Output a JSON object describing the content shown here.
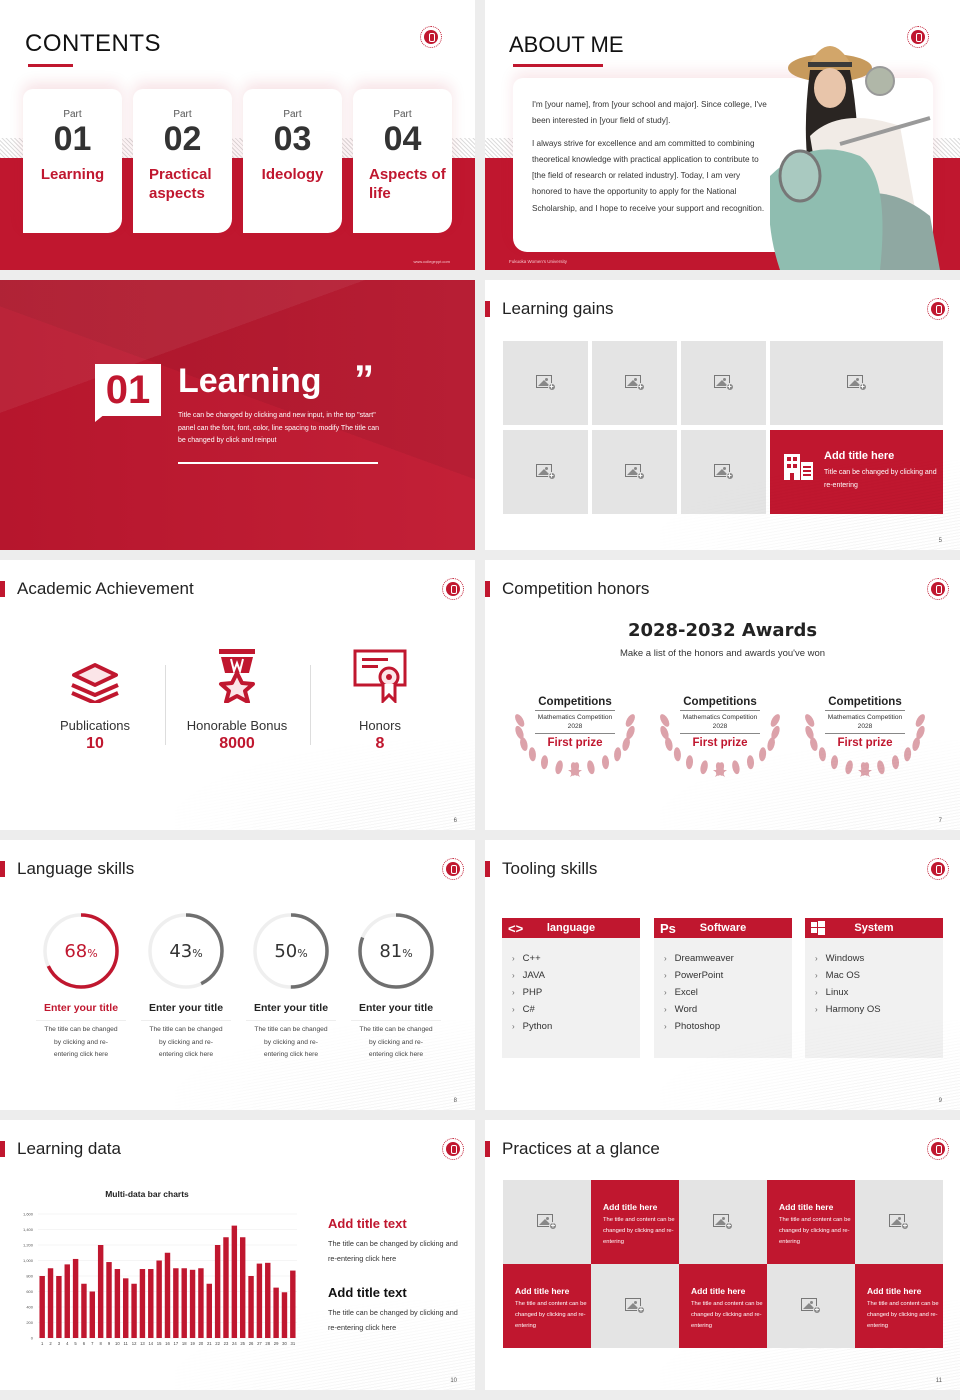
{
  "colors": {
    "accent": "#c0172f",
    "placeholder_gray": "#e4e4e4",
    "ring_gray": "#6f6f6f",
    "ring_track": "#efefef"
  },
  "slide1": {
    "title": "CONTENTS",
    "parts": [
      {
        "label": "Part",
        "number": "01",
        "name": "Learning"
      },
      {
        "label": "Part",
        "number": "02",
        "name": "Practical aspects"
      },
      {
        "label": "Part",
        "number": "03",
        "name": "Ideology"
      },
      {
        "label": "Part",
        "number": "04",
        "name": "Aspects of life"
      }
    ],
    "website": "www.collegeppt.com",
    "logo_icon": "university-seal-icon"
  },
  "slide2": {
    "title": "ABOUT ME",
    "bio_p1": "I'm [your name], from [your school and major]. Since college, I've been interested in [your field of study].",
    "bio_p2": "I always strive for excellence and am committed to combining theoretical knowledge with practical application to contribute to [the field of research or related industry]. Today, I am very honored to have the opportunity to apply for the National Scholarship, and I hope to receive your support and recognition.",
    "university": "Fukuoka Women's University",
    "photo": "student-on-scooter-photo"
  },
  "slide3": {
    "number": "01",
    "title": "Learning",
    "quote_mark": "”",
    "description": "Title can be changed by clicking and new input, in the top \"start\" panel can the font, font, color, line spacing to modify The title can be changed by click and reinput"
  },
  "slide4": {
    "title": "Learning gains",
    "placeholder_icon": "image-add-icon",
    "feature": {
      "icon": "building-icon",
      "title": "Add title here",
      "text": "Title can be changed by clicking and re-entering"
    },
    "page": "5"
  },
  "slide5": {
    "title": "Academic Achievement",
    "stats": [
      {
        "icon": "paper-stack-icon",
        "label": "Publications",
        "value": "10"
      },
      {
        "icon": "medal-star-icon",
        "label": "Honorable Bonus",
        "value": "8000"
      },
      {
        "icon": "certificate-icon",
        "label": "Honors",
        "value": "8"
      }
    ],
    "page": "6"
  },
  "slide6": {
    "title": "Competition honors",
    "heading": "2028-2032 Awards",
    "subheading": "Make a list of the honors and awards you've won",
    "awards": [
      {
        "category": "Competitions",
        "name": "Mathematics Competition 2028",
        "prize": "First prize"
      },
      {
        "category": "Competitions",
        "name": "Mathematics Competition 2028",
        "prize": "First prize"
      },
      {
        "category": "Competitions",
        "name": "Mathematics Competition 2028",
        "prize": "First prize"
      }
    ],
    "page": "7"
  },
  "slide7": {
    "title": "Language skills",
    "skills": [
      {
        "percent": 68,
        "pct_text": "68",
        "title": "Enter your title",
        "text": "The title can be changed by clicking and re-entering click here"
      },
      {
        "percent": 43,
        "pct_text": "43",
        "title": "Enter your title",
        "text": "The title can be changed by clicking and re-entering click here"
      },
      {
        "percent": 50,
        "pct_text": "50",
        "title": "Enter your title",
        "text": "The title can be changed by clicking and re-entering click here"
      },
      {
        "percent": 81,
        "pct_text": "81",
        "title": "Enter your title",
        "text": "The title can be changed by clicking and re-entering click here"
      }
    ],
    "pct_symbol": "%",
    "page": "8"
  },
  "slide8": {
    "title": "Tooling skills",
    "groups": [
      {
        "icon": "code-brackets-icon",
        "icon_glyph": "<>",
        "label": "language",
        "items": [
          "C++",
          "JAVA",
          "PHP",
          "C#",
          "Python"
        ]
      },
      {
        "icon": "photoshop-icon",
        "icon_glyph": "Ps",
        "label": "Software",
        "items": [
          "Dreamweaver",
          "PowerPoint",
          "Excel",
          "Word",
          "Photoshop"
        ]
      },
      {
        "icon": "windows-icon",
        "icon_glyph": "",
        "label": "System",
        "items": [
          "Windows",
          "Mac OS",
          "Linux",
          "Harmony OS"
        ]
      }
    ],
    "page": "9"
  },
  "slide9": {
    "title": "Learning data",
    "blocks": [
      {
        "title": "Add title text",
        "text": "The title can be changed by clicking and re-entering click here"
      },
      {
        "title": "Add title text",
        "text": "The title can be changed by clicking and re-entering click here"
      }
    ],
    "page": "10"
  },
  "slide10": {
    "title": "Practices at a glance",
    "cells": [
      {
        "type": "image"
      },
      {
        "type": "text",
        "title": "Add title here",
        "text": "The title and content can be changed by clicking and re-entering"
      },
      {
        "type": "image"
      },
      {
        "type": "text",
        "title": "Add title here",
        "text": "The title and content can be changed by clicking and re-entering"
      },
      {
        "type": "image"
      },
      {
        "type": "text",
        "title": "Add title here",
        "text": "The title and content can be changed by clicking and re-entering"
      },
      {
        "type": "image"
      },
      {
        "type": "text",
        "title": "Add title here",
        "text": "The title and content can be changed by clicking and re-entering"
      },
      {
        "type": "image"
      },
      {
        "type": "text",
        "title": "Add title here",
        "text": "The title and content can be changed by clicking and re-entering"
      }
    ],
    "page": "11"
  },
  "chart_data": {
    "type": "bar",
    "title": "Multi-data bar charts",
    "xlabel": "",
    "ylabel": "",
    "categories": [
      "1",
      "2",
      "3",
      "4",
      "5",
      "6",
      "7",
      "8",
      "9",
      "10",
      "11",
      "12",
      "13",
      "14",
      "15",
      "16",
      "17",
      "18",
      "19",
      "20",
      "21",
      "22",
      "23",
      "24",
      "25",
      "26",
      "27",
      "28",
      "29",
      "30",
      "31"
    ],
    "values": [
      800,
      900,
      800,
      950,
      1020,
      700,
      600,
      1200,
      980,
      890,
      770,
      700,
      890,
      890,
      1000,
      1100,
      900,
      900,
      880,
      900,
      700,
      1200,
      1300,
      1450,
      1300,
      800,
      960,
      970,
      650,
      590,
      870
    ],
    "ylim": [
      0,
      1600
    ],
    "yticks": [
      0,
      200,
      400,
      600,
      800,
      1000,
      1200,
      1400,
      1600
    ],
    "ytick_labels": [
      "0",
      "200",
      "400",
      "600",
      "800",
      "1,000",
      "1,200",
      "1,400",
      "1,600"
    ],
    "grid": true,
    "legend": "none",
    "bar_color": "#c0172f"
  }
}
